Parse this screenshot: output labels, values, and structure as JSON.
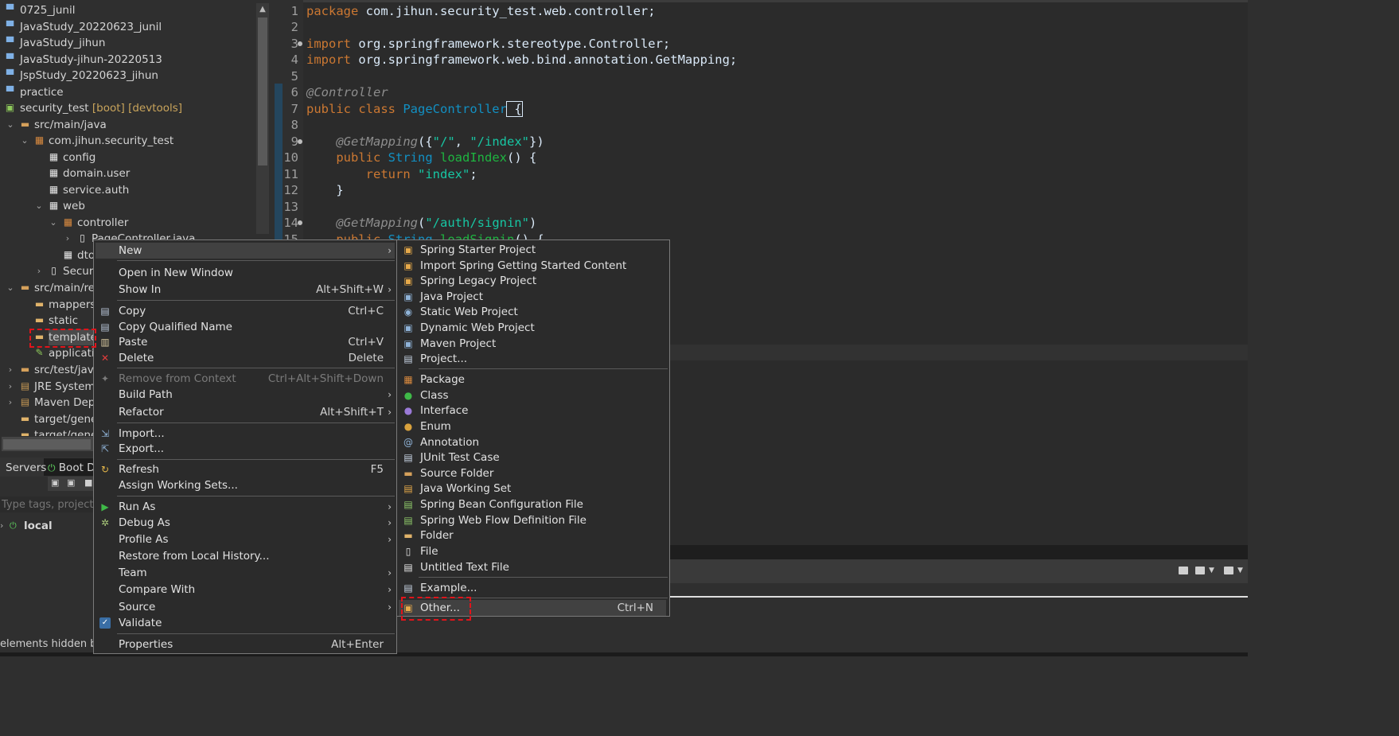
{
  "explorer": {
    "items": [
      {
        "label": "0725_junil",
        "icon": "project-folder-icon"
      },
      {
        "label": "JavaStudy_20220623_junil",
        "icon": "project-folder-icon"
      },
      {
        "label": "JavaStudy_jihun",
        "icon": "project-folder-icon"
      },
      {
        "label": "JavaStudy-jihun-20220513",
        "icon": "project-folder-icon"
      },
      {
        "label": "JspStudy_20220623_jihun",
        "icon": "project-folder-icon"
      },
      {
        "label": "practice",
        "icon": "project-folder-icon"
      },
      {
        "label": "security_test",
        "tags": "[boot] [devtools]",
        "icon": "spring-boot-project-icon"
      },
      {
        "label": "src/main/java",
        "icon": "source-folder-icon"
      },
      {
        "label": "com.jihun.security_test",
        "icon": "package-icon"
      },
      {
        "label": "config",
        "icon": "package-icon"
      },
      {
        "label": "domain.user",
        "icon": "package-icon"
      },
      {
        "label": "service.auth",
        "icon": "package-icon"
      },
      {
        "label": "web",
        "icon": "package-icon"
      },
      {
        "label": "controller",
        "icon": "package-icon"
      },
      {
        "label": "PageController.java",
        "icon": "java-file-icon"
      },
      {
        "label": "dto",
        "icon": "package-icon"
      },
      {
        "label": "SecurityTestApplication.java",
        "icon": "java-file-icon"
      },
      {
        "label": "src/main/resources",
        "icon": "source-folder-icon"
      },
      {
        "label": "mappers",
        "icon": "folder-icon"
      },
      {
        "label": "static",
        "icon": "folder-icon"
      },
      {
        "label": "templates",
        "icon": "folder-icon"
      },
      {
        "label": "application.yml",
        "icon": "config-file-icon"
      },
      {
        "label": "src/test/java",
        "icon": "source-folder-icon"
      },
      {
        "label": "JRE System Library",
        "icon": "library-icon"
      },
      {
        "label": "Maven Dependencies",
        "icon": "library-icon"
      },
      {
        "label": "target/generated-sources",
        "icon": "folder-icon"
      },
      {
        "label": "target/generated-test-sources",
        "icon": "folder-icon"
      }
    ]
  },
  "editor": {
    "lines": [
      {
        "n": "1"
      },
      {
        "n": "2"
      },
      {
        "n": "3"
      },
      {
        "n": "4"
      },
      {
        "n": "5"
      },
      {
        "n": "6"
      },
      {
        "n": "7"
      },
      {
        "n": "8"
      },
      {
        "n": "9"
      },
      {
        "n": "10"
      },
      {
        "n": "11"
      },
      {
        "n": "12"
      },
      {
        "n": "13"
      },
      {
        "n": "14"
      },
      {
        "n": "15"
      }
    ],
    "tokens": {
      "package_kw": "package",
      "package_name": " com.jihun.security_test.web.controller;",
      "import_kw": "import",
      "import1": " org.springframework.stereotype.Controller;",
      "import2": " org.springframework.web.bind.annotation.GetMapping;",
      "controller_ann": "@Controller",
      "public_class": "public class",
      "class_name": "PageController",
      "brace_open": " {",
      "getmapping_ann": "@GetMapping",
      "index_args_open": "({",
      "str_root": "\"/\"",
      "comma": ", ",
      "str_index": "\"/index\"",
      "index_args_close": "})",
      "public_kw": "public",
      "string_type": "String",
      "load_index": "loadIndex",
      "parens_brace": "() {",
      "return_kw": "return",
      "index_return": "\"index\"",
      "semicolon": ";",
      "brace_close": "}",
      "signin_open": "(",
      "str_signin": "\"/auth/signin\"",
      "signin_close": ")",
      "load_signin": "loadSignin"
    }
  },
  "bottom_panel": {
    "servers_tab": "Servers",
    "boot_tab": "Boot Dashboard",
    "filter_placeholder": "Type tags, projects, or working set names to match",
    "local_label": "local",
    "status_text": "elements hidden by filter"
  },
  "context_menu": {
    "items": [
      {
        "label": "New",
        "submenu": true
      },
      {
        "label": "Open in New Window"
      },
      {
        "label": "Show In",
        "accel": "Alt+Shift+W",
        "submenu": true
      },
      {
        "label": "Copy",
        "accel": "Ctrl+C",
        "icon": "copy-icon"
      },
      {
        "label": "Copy Qualified Name",
        "icon": "copy-qualified-icon"
      },
      {
        "label": "Paste",
        "accel": "Ctrl+V",
        "icon": "paste-icon"
      },
      {
        "label": "Delete",
        "accel": "Delete",
        "icon": "delete-icon"
      },
      {
        "label": "Remove from Context",
        "accel": "Ctrl+Alt+Shift+Down",
        "disabled": true,
        "icon": "remove-context-icon"
      },
      {
        "label": "Build Path",
        "submenu": true
      },
      {
        "label": "Refactor",
        "accel": "Alt+Shift+T",
        "submenu": true
      },
      {
        "label": "Import...",
        "icon": "import-icon"
      },
      {
        "label": "Export...",
        "icon": "export-icon"
      },
      {
        "label": "Refresh",
        "accel": "F5",
        "icon": "refresh-icon"
      },
      {
        "label": "Assign Working Sets..."
      },
      {
        "label": "Run As",
        "submenu": true,
        "icon": "run-icon"
      },
      {
        "label": "Debug As",
        "submenu": true,
        "icon": "debug-icon"
      },
      {
        "label": "Profile As",
        "submenu": true
      },
      {
        "label": "Restore from Local History..."
      },
      {
        "label": "Team",
        "submenu": true
      },
      {
        "label": "Compare With",
        "submenu": true
      },
      {
        "label": "Source",
        "submenu": true
      },
      {
        "label": "Validate",
        "icon": "validate-check-icon"
      },
      {
        "label": "Properties",
        "accel": "Alt+Enter"
      }
    ]
  },
  "new_submenu": {
    "items": [
      {
        "label": "Spring Starter Project",
        "icon": "spring-starter-icon"
      },
      {
        "label": "Import Spring Getting Started Content",
        "icon": "spring-import-icon"
      },
      {
        "label": "Spring Legacy Project",
        "icon": "spring-legacy-icon"
      },
      {
        "label": "Java Project",
        "icon": "java-project-icon"
      },
      {
        "label": "Static Web Project",
        "icon": "static-web-icon"
      },
      {
        "label": "Dynamic Web Project",
        "icon": "dynamic-web-icon"
      },
      {
        "label": "Maven Project",
        "icon": "maven-project-icon"
      },
      {
        "label": "Project...",
        "icon": "project-icon"
      },
      {
        "label": "Package",
        "icon": "package-icon"
      },
      {
        "label": "Class",
        "icon": "class-icon"
      },
      {
        "label": "Interface",
        "icon": "interface-icon"
      },
      {
        "label": "Enum",
        "icon": "enum-icon"
      },
      {
        "label": "Annotation",
        "icon": "annotation-icon"
      },
      {
        "label": "JUnit Test Case",
        "icon": "junit-icon"
      },
      {
        "label": "Source Folder",
        "icon": "source-folder-icon"
      },
      {
        "label": "Java Working Set",
        "icon": "working-set-icon"
      },
      {
        "label": "Spring Bean Configuration File",
        "icon": "spring-bean-icon"
      },
      {
        "label": "Spring Web Flow Definition File",
        "icon": "web-flow-icon"
      },
      {
        "label": "Folder",
        "icon": "folder-icon"
      },
      {
        "label": "File",
        "icon": "file-icon"
      },
      {
        "label": "Untitled Text File",
        "icon": "text-file-icon"
      },
      {
        "label": "Example...",
        "icon": "example-icon"
      },
      {
        "label": "Other...",
        "accel": "Ctrl+N",
        "icon": "other-wizard-icon"
      }
    ]
  },
  "colors": {
    "background": "#2f2f2f",
    "editor_background": "#2b2b2b",
    "keyword": "#cc7832",
    "string": "#17c6a3",
    "type": "#1290c3",
    "annotation_highlight": "#e0141b"
  }
}
